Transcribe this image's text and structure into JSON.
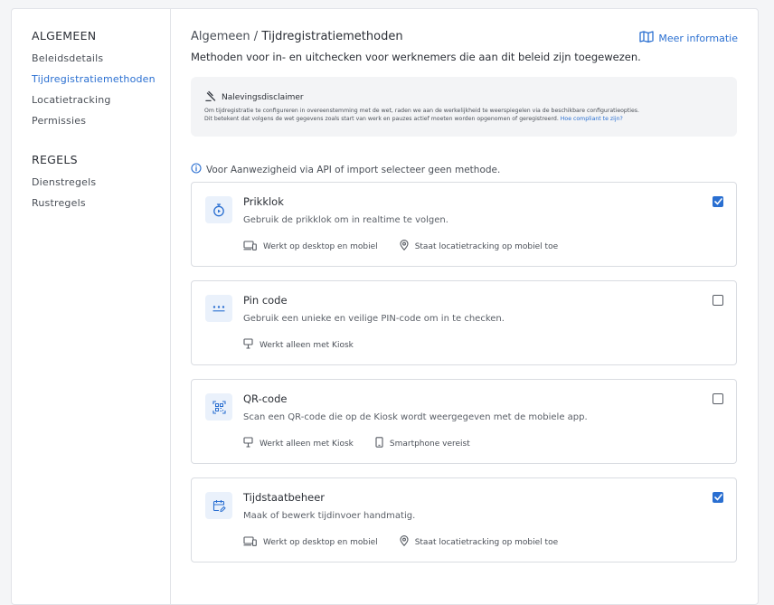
{
  "sidebar": {
    "sections": [
      {
        "heading": "ALGEMEEN",
        "items": [
          "Beleidsdetails",
          "Tijdregistratiemethoden",
          "Locatietracking",
          "Permissies"
        ]
      },
      {
        "heading": "REGELS",
        "items": [
          "Dienstregels",
          "Rustregels"
        ]
      }
    ],
    "active_item": "Tijdregistratiemethoden"
  },
  "header": {
    "breadcrumb_parent": "Algemeen",
    "breadcrumb_sep": " / ",
    "breadcrumb_current": "Tijdregistratiemethoden",
    "more_info": "Meer informatie",
    "subtitle": "Methoden voor in- en uitchecken voor werknemers die aan dit beleid zijn toegewezen."
  },
  "disclaimer": {
    "title": "Nalevingsdisclaimer",
    "text_line1": "Om tijdregistratie te configureren in overeenstemming met de wet, raden we aan de werkelijkheid te weerspiegelen via de beschikbare configuratieopties.",
    "text_line2": "Dit betekent dat volgens de wet gegevens zoals start van werk en pauzes actief moeten worden opgenomen of geregistreerd.",
    "link": "Hoe compliant te zijn?"
  },
  "info_note": "Voor Aanwezigheid via API of import selecteer geen methode.",
  "methods": [
    {
      "title": "Prikklok",
      "description": "Gebruik de prikklok om in realtime te volgen.",
      "icon": "stopwatch-icon",
      "checked": true,
      "features": [
        {
          "icon": "devices-icon",
          "label": "Werkt op desktop en mobiel"
        },
        {
          "icon": "location-pin-icon",
          "label": "Staat locatietracking op mobiel toe"
        }
      ]
    },
    {
      "title": "Pin code",
      "description": "Gebruik een unieke en veilige PIN-code om in te checken.",
      "icon": "pin-dots-icon",
      "checked": false,
      "features": [
        {
          "icon": "kiosk-icon",
          "label": "Werkt alleen met Kiosk"
        }
      ]
    },
    {
      "title": "QR-code",
      "description": "Scan een QR-code die op de Kiosk wordt weergegeven met de mobiele app.",
      "icon": "qr-code-icon",
      "checked": false,
      "features": [
        {
          "icon": "kiosk-icon",
          "label": "Werkt alleen met Kiosk"
        },
        {
          "icon": "smartphone-icon",
          "label": "Smartphone vereist"
        }
      ]
    },
    {
      "title": "Tijdstaatbeheer",
      "description": "Maak of bewerk tijdinvoer handmatig.",
      "icon": "calendar-edit-icon",
      "checked": true,
      "features": [
        {
          "icon": "devices-icon",
          "label": "Werkt op desktop en mobiel"
        },
        {
          "icon": "location-pin-icon",
          "label": "Staat locatietracking op mobiel toe"
        }
      ]
    }
  ],
  "colors": {
    "accent": "#2a6fd1",
    "icon_bg": "#eaf1fb",
    "border": "#d9dce1"
  }
}
